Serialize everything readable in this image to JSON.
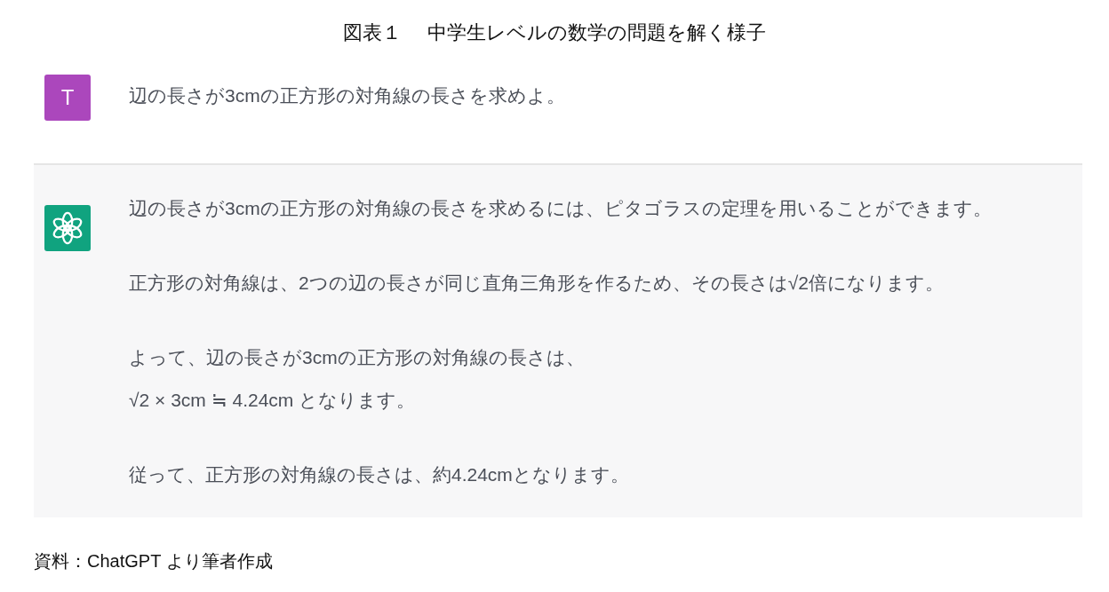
{
  "figure_caption": "図表１　 中学生レベルの数学の問題を解く様子",
  "messages": [
    {
      "kind": "user",
      "avatar": {
        "kind": "letter",
        "text": "T",
        "color": "#ab47bc"
      },
      "paragraphs": [
        [
          "辺の長さが3cmの正方形の対角線の長さを求めよ。"
        ]
      ]
    },
    {
      "kind": "assistant",
      "avatar": {
        "kind": "logo",
        "color": "#10a37f"
      },
      "paragraphs": [
        [
          "辺の長さが3cmの正方形の対角線の長さを求めるには、ピタゴラスの定理を用いることができます。"
        ],
        [
          "正方形の対角線は、2つの辺の長さが同じ直角三角形を作るため、その長さは√2倍になります。"
        ],
        [
          "よって、辺の長さが3cmの正方形の対角線の長さは、",
          "√2 × 3cm ≒ 4.24cm となります。"
        ],
        [
          "従って、正方形の対角線の長さは、約4.24cmとなります。"
        ]
      ]
    }
  ],
  "source": "資料：ChatGPT より筆者作成"
}
